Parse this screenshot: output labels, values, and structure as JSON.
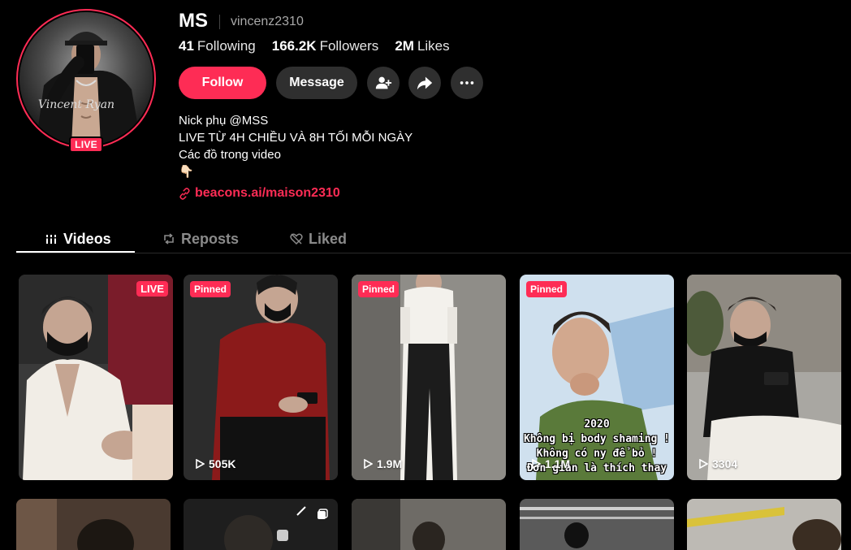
{
  "profile": {
    "display_name": "MS",
    "handle": "vincenz2310",
    "live_label": "LIVE",
    "avatar_watermark": "Vincent Ryan"
  },
  "stats": {
    "following_count": "41",
    "following_label": "Following",
    "followers_count": "166.2K",
    "followers_label": "Followers",
    "likes_count": "2M",
    "likes_label": "Likes"
  },
  "actions": {
    "follow_label": "Follow",
    "message_label": "Message",
    "add_friend_icon": "person-add-icon",
    "share_icon": "share-arrow-icon",
    "more_icon": "more-dots-icon"
  },
  "bio": {
    "line1": "Nick phụ @MSS",
    "line2": "LIVE TỪ 4H CHIỀU VÀ 8H TỐI MỖI NGÀY",
    "line3": "Các đồ trong video",
    "line4": "👇🏻",
    "link_text": "beacons.ai/maison2310"
  },
  "tabs": [
    {
      "label": "Videos",
      "icon": "grid-bars-icon",
      "active": true
    },
    {
      "label": "Reposts",
      "icon": "repost-icon",
      "active": false
    },
    {
      "label": "Liked",
      "icon": "heart-hidden-icon",
      "active": false
    }
  ],
  "videos": [
    {
      "badge": "LIVE",
      "badge_type": "live",
      "views": ""
    },
    {
      "badge": "Pinned",
      "badge_type": "pinned",
      "views": "505K"
    },
    {
      "badge": "Pinned",
      "badge_type": "pinned",
      "views": "1.9M"
    },
    {
      "badge": "Pinned",
      "badge_type": "pinned",
      "views": "1.1M",
      "caption": [
        "2020",
        "Không bị body shaming !",
        "Không có ny để bỏ !",
        "Đơn giản là thích thay"
      ]
    },
    {
      "badge": "",
      "badge_type": "",
      "views": "3304"
    }
  ],
  "colors": {
    "accent": "#fe2c55",
    "background": "#000000",
    "button_secondary": "#2f2f2f",
    "muted_text": "#8a8a8a"
  }
}
